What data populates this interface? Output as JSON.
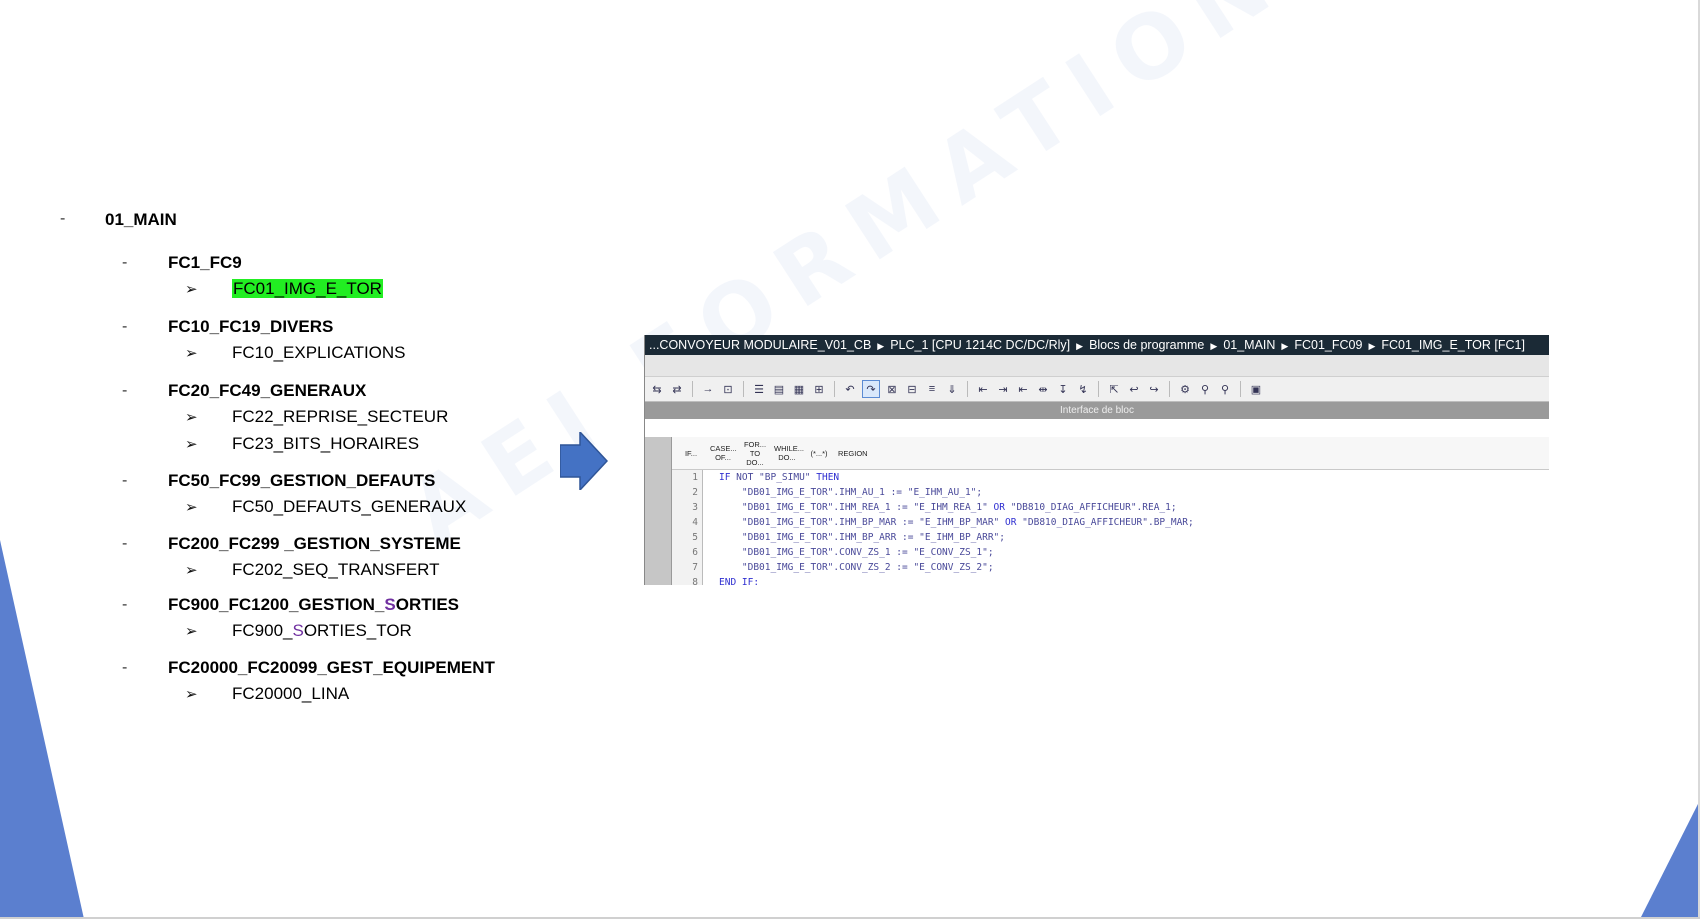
{
  "tree": {
    "root": {
      "label": "01_MAIN",
      "dash": "-"
    },
    "groups": [
      {
        "label": "FC1_FC9",
        "items": [
          {
            "label": "FC01_IMG_E_TOR",
            "highlighted": true
          }
        ]
      },
      {
        "label": "FC10_FC19_DIVERS",
        "items": [
          {
            "label": "FC10_EXPLICATIONS"
          }
        ]
      },
      {
        "label": "FC20_FC49_GENERAUX",
        "items": [
          {
            "label": "FC22_REPRISE_SECTEUR"
          },
          {
            "label": "FC23_BITS_HORAIRES"
          }
        ]
      },
      {
        "label": "FC50_FC99_GESTION_DEFAUTS",
        "items": [
          {
            "label": "FC50_DEFAUTS_GENERAUX"
          }
        ]
      },
      {
        "label": "FC200_FC299 _GESTION_SYSTEME",
        "items": [
          {
            "label": "FC202_SEQ_TRANSFERT"
          }
        ]
      },
      {
        "label_pre": "FC900_FC1200_GESTION_",
        "label_accent": "S",
        "label_post": "ORTIES",
        "items": [
          {
            "label_pre": "FC900_",
            "label_accent": "S",
            "label_post": "ORTIES_TOR"
          }
        ]
      },
      {
        "label": "FC20000_FC20099_GEST_EQUIPEMENT",
        "items": [
          {
            "label": "FC20000_LINA"
          }
        ]
      }
    ],
    "bullet_glyph": "➢",
    "dash_glyph": "-"
  },
  "watermark": "AEI FORMATION OUEST",
  "editor": {
    "breadcrumb": [
      "...CONVOYEUR MODULAIRE_V01_CB",
      "PLC_1 [CPU 1214C DC/DC/Rly]",
      "Blocs de programme",
      "01_MAIN",
      "FC01_FC09",
      "FC01_IMG_E_TOR [FC1]"
    ],
    "breadcrumb_sep": "▶",
    "interface_label": "Interface de bloc",
    "snippets": [
      "IF...",
      "CASE... OF...",
      "FOR... TO DO...",
      "WHILE... DO...",
      "(*...*)",
      "REGION"
    ],
    "code_lines": [
      {
        "n": "1",
        "parts": [
          {
            "t": "IF ",
            "kw": true
          },
          {
            "t": "NOT \"BP_SIMU\" "
          },
          {
            "t": "THEN",
            "kw": true
          }
        ]
      },
      {
        "n": "2",
        "parts": [
          {
            "t": "    \"DB01_IMG_E_TOR\".IHM_AU_1 := \"E_IHM_AU_1\";"
          }
        ]
      },
      {
        "n": "3",
        "parts": [
          {
            "t": "    \"DB01_IMG_E_TOR\".IHM_REA_1 := \"E_IHM_REA_1\" "
          },
          {
            "t": "OR",
            "kw": true
          },
          {
            "t": " \"DB810_DIAG_AFFICHEUR\".REA_1;"
          }
        ]
      },
      {
        "n": "4",
        "parts": [
          {
            "t": "    \"DB01_IMG_E_TOR\".IHM_BP_MAR := \"E_IHM_BP_MAR\" "
          },
          {
            "t": "OR",
            "kw": true
          },
          {
            "t": " \"DB810_DIAG_AFFICHEUR\".BP_MAR;"
          }
        ]
      },
      {
        "n": "5",
        "parts": [
          {
            "t": "    \"DB01_IMG_E_TOR\".IHM_BP_ARR := \"E_IHM_BP_ARR\";"
          }
        ]
      },
      {
        "n": "6",
        "parts": [
          {
            "t": "    \"DB01_IMG_E_TOR\".CONV_ZS_1 := \"E_CONV_ZS_1\";"
          }
        ]
      },
      {
        "n": "7",
        "parts": [
          {
            "t": "    \"DB01_IMG_E_TOR\".CONV_ZS_2 := \"E_CONV_ZS_2\";"
          }
        ]
      },
      {
        "n": "8",
        "parts": [
          {
            "t": "END_IF;",
            "kw": true
          }
        ]
      }
    ]
  },
  "colors": {
    "highlight": "#22ee22",
    "accent_letter": "#7030a0",
    "arrow": "#4472c4",
    "deco": "#5b7fcf",
    "titlebar": "#1b2a36"
  }
}
